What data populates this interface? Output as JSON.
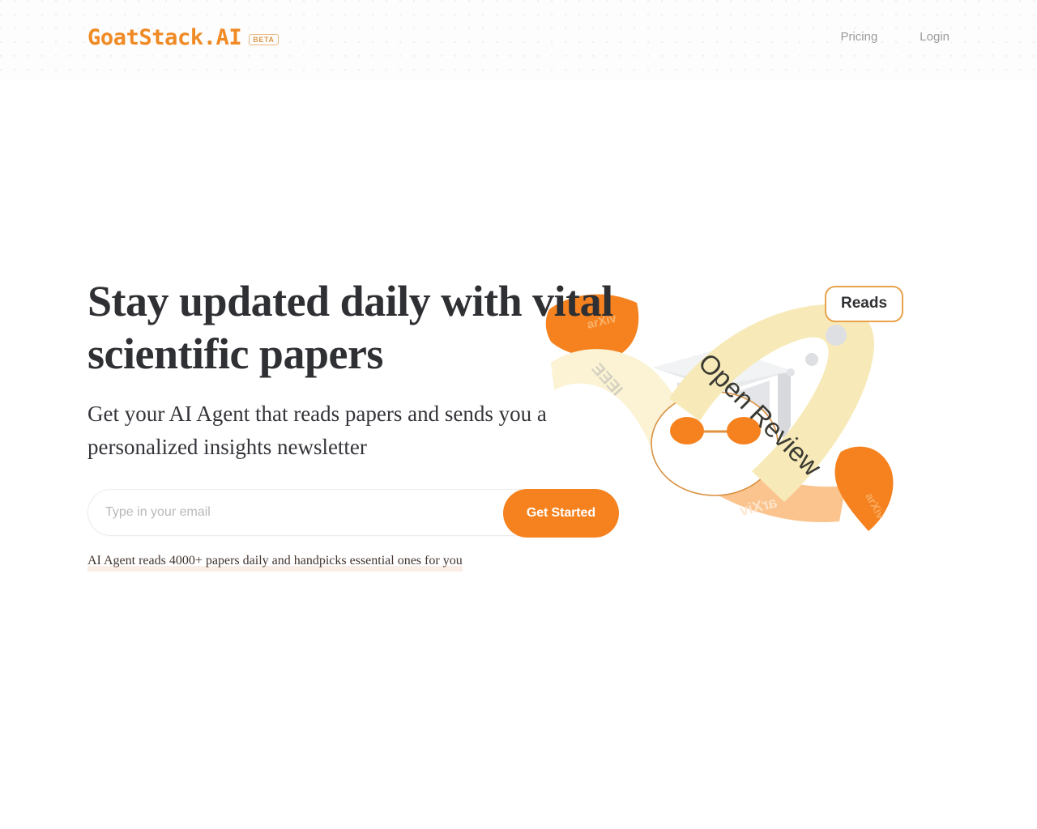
{
  "brand": {
    "name": "GoatStack.AI",
    "badge": "BETA"
  },
  "nav": {
    "links": [
      {
        "label": "Pricing",
        "name": "nav-link-pricing"
      },
      {
        "label": "Login",
        "name": "nav-link-login"
      }
    ]
  },
  "hero": {
    "headline": "Stay updated daily with vital scientific papers",
    "subheadline": "Get your AI Agent that reads papers and sends you a personalized insights newsletter",
    "caption": "AI Agent reads 4000+ papers daily and handpicks essential ones for you"
  },
  "signup": {
    "placeholder": "Type in your email",
    "value": "",
    "button_label": "Get Started",
    "icon": "envelope-icon"
  },
  "illustration": {
    "bubble_label": "Reads",
    "ribbons": [
      {
        "label": "Open Review",
        "color": "#f7eab8"
      },
      {
        "label": "IEEE",
        "color": "#fbf3d4"
      },
      {
        "label": "arXiv",
        "color": "#fbc48e"
      }
    ],
    "mascot": "goat-graduate-icon"
  },
  "colors": {
    "accent": "#f5821f",
    "brand": "#f08a24",
    "headline": "#2f3033",
    "muted": "#9b9b9b",
    "ribbon_yellow": "#f7eab8",
    "ribbon_peach": "#fbc48e",
    "bubble_border": "#e8a34c"
  }
}
